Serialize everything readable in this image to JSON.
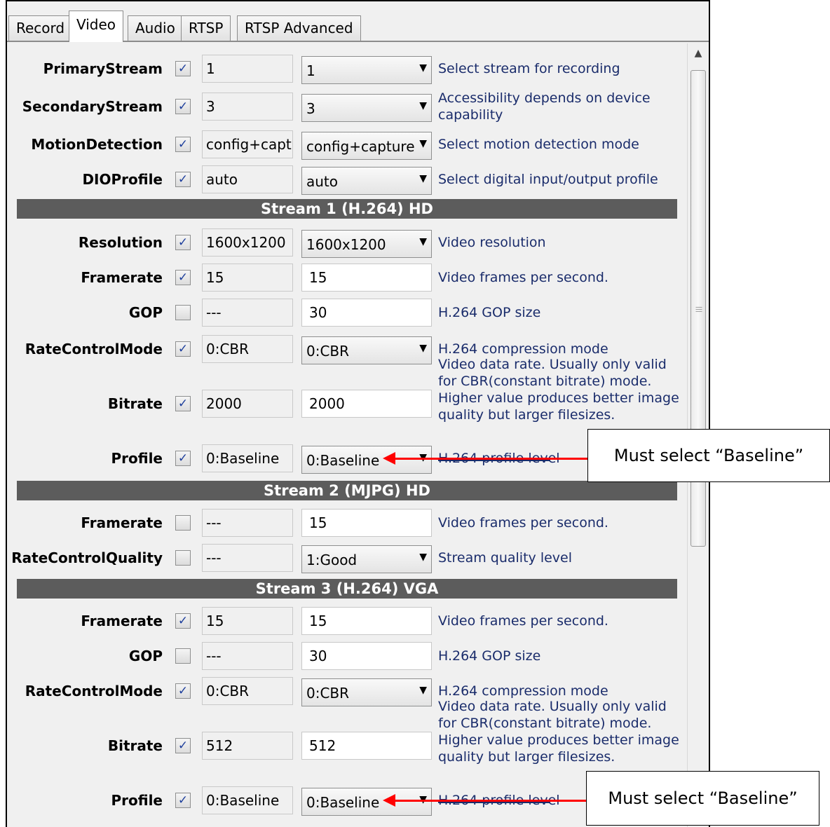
{
  "tabs": [
    "Record",
    "Video",
    "Audio",
    "RTSP",
    "RTSP Advanced"
  ],
  "active_tab": "Video",
  "rows_top": [
    {
      "label": "PrimaryStream",
      "checked": true,
      "current": "1",
      "value": "1",
      "control": "select",
      "desc": "Select stream for recording"
    },
    {
      "label": "SecondaryStream",
      "checked": true,
      "current": "3",
      "value": "3",
      "control": "select",
      "desc": "Accessibility depends on device capability"
    },
    {
      "label": "MotionDetection",
      "checked": true,
      "current": "config+captu",
      "value": "config+capture",
      "control": "select",
      "desc": "Select motion detection mode"
    },
    {
      "label": "DIOProfile",
      "checked": true,
      "current": "auto",
      "value": "auto",
      "control": "select",
      "desc": "Select digital input/output profile"
    }
  ],
  "sections": [
    {
      "title": "Stream 1 (H.264) HD"
    },
    {
      "title": "Stream 2 (MJPG) HD"
    },
    {
      "title": "Stream 3 (H.264) VGA"
    }
  ],
  "stream1": [
    {
      "label": "Resolution",
      "checked": true,
      "current": "1600x1200",
      "value": "1600x1200",
      "control": "select",
      "desc": "Video resolution"
    },
    {
      "label": "Framerate",
      "checked": true,
      "current": "15",
      "value": "15",
      "control": "input",
      "desc": "Video frames per second."
    },
    {
      "label": "GOP",
      "checked": false,
      "current": "---",
      "value": "30",
      "control": "input",
      "desc": "H.264 GOP size"
    },
    {
      "label": "RateControlMode",
      "checked": true,
      "current": "0:CBR",
      "value": "0:CBR",
      "control": "select",
      "desc": "H.264 compression mode"
    },
    {
      "label": "Bitrate",
      "checked": true,
      "current": "2000",
      "value": "2000",
      "control": "input",
      "desc": "Video data rate. Usually only valid for CBR(constant bitrate) mode. Higher value produces better image quality but larger filesizes."
    },
    {
      "label": "Profile",
      "checked": true,
      "current": "0:Baseline",
      "value": "0:Baseline",
      "control": "select",
      "desc": "H.264 profile level"
    }
  ],
  "stream2": [
    {
      "label": "Framerate",
      "checked": false,
      "current": "---",
      "value": "15",
      "control": "input",
      "desc": "Video frames per second."
    },
    {
      "label": "RateControlQuality",
      "checked": false,
      "current": "---",
      "value": "1:Good",
      "control": "select",
      "desc": "Stream quality level"
    }
  ],
  "stream3": [
    {
      "label": "Framerate",
      "checked": true,
      "current": "15",
      "value": "15",
      "control": "input",
      "desc": "Video frames per second."
    },
    {
      "label": "GOP",
      "checked": false,
      "current": "---",
      "value": "30",
      "control": "input",
      "desc": "H.264 GOP size"
    },
    {
      "label": "RateControlMode",
      "checked": true,
      "current": "0:CBR",
      "value": "0:CBR",
      "control": "select",
      "desc": "H.264 compression mode"
    },
    {
      "label": "Bitrate",
      "checked": true,
      "current": "512",
      "value": "512",
      "control": "input",
      "desc": "Video data rate. Usually only valid for CBR(constant bitrate) mode. Higher value produces better image quality but larger filesizes."
    },
    {
      "label": "Profile",
      "checked": true,
      "current": "0:Baseline",
      "value": "0:Baseline",
      "control": "select",
      "desc": "H.264 profile level"
    }
  ],
  "callouts": [
    "Must select “Baseline”",
    "Must select “Baseline”"
  ],
  "colors": {
    "section_bg": "#5c5c5c",
    "desc_text": "#1a2c6b",
    "arrow": "#ff0000"
  }
}
